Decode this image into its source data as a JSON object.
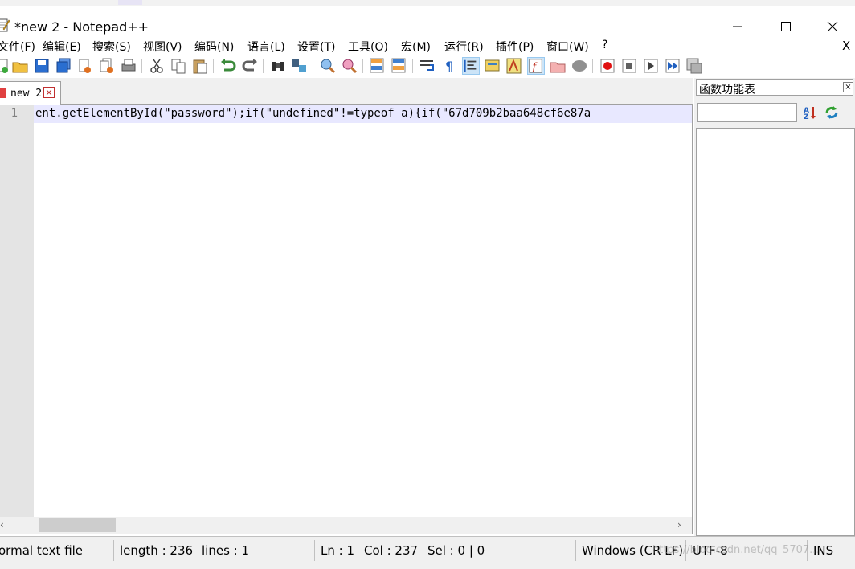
{
  "window": {
    "title": "*new 2 - Notepad++"
  },
  "menu": {
    "items": [
      "文件(F)",
      "编辑(E)",
      "搜索(S)",
      "视图(V)",
      "编码(N)",
      "语言(L)",
      "设置(T)",
      "工具(O)",
      "宏(M)",
      "运行(R)",
      "插件(P)",
      "窗口(W)",
      "?"
    ],
    "close_label": "X"
  },
  "tab": {
    "label": "new 2",
    "close_glyph": "✕"
  },
  "editor": {
    "line_number": "1",
    "code": "ent.getElementById(\"password\");if(\"undefined\"!=typeof a){if(\"67d709b2baa648cf6e87a"
  },
  "function_panel": {
    "title": "函数功能表",
    "close_glyph": "×",
    "search_value": ""
  },
  "status": {
    "file_type": "ormal text file",
    "length": "length : 236",
    "lines": "lines : 1",
    "ln": "Ln : 1",
    "col": "Col : 237",
    "sel": "Sel : 0 | 0",
    "eol": "Windows (CR LF)",
    "encoding": "UTF-8",
    "mode": "INS"
  },
  "watermark": "https://blog.csdn.net/qq_5707..."
}
